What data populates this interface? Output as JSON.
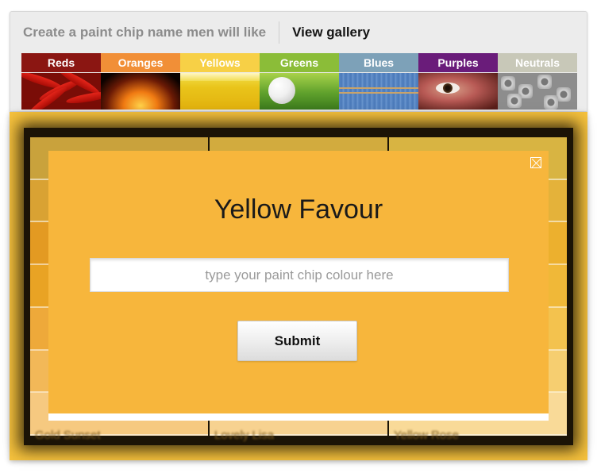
{
  "nav": {
    "create_label": "Create a paint chip name men will like",
    "gallery_label": "View gallery"
  },
  "categories": [
    {
      "label": "Reds",
      "color": "#8b1612"
    },
    {
      "label": "Oranges",
      "color": "#f18f37"
    },
    {
      "label": "Yellows",
      "color": "#f7d046"
    },
    {
      "label": "Greens",
      "color": "#8bbd38"
    },
    {
      "label": "Blues",
      "color": "#7da1b8"
    },
    {
      "label": "Purples",
      "color": "#6a1c7a"
    },
    {
      "label": "Neutrals",
      "color": "#c8c8b8"
    }
  ],
  "background_chips": {
    "column_names": [
      "Gold Sunset",
      "Lovely Lisa",
      "Yellow Rose"
    ]
  },
  "modal": {
    "title": "Yellow Favour",
    "input_placeholder": "type your paint chip colour here",
    "input_value": "",
    "submit_label": "Submit"
  }
}
